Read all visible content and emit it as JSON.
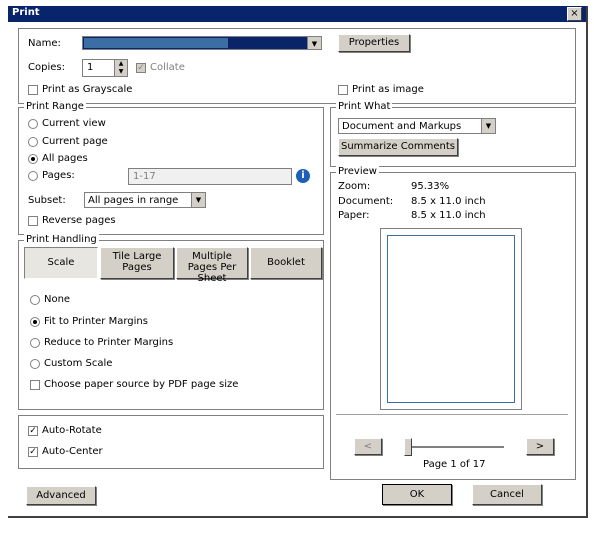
{
  "window": {
    "title": "Print",
    "close_glyph": "×"
  },
  "printer": {
    "name_label": "Name:",
    "properties_label": "Properties",
    "copies_label": "Copies:",
    "copies_value": "1",
    "collate_label": "Collate",
    "grayscale_label": "Print as Grayscale",
    "print_as_image_label": "Print as image"
  },
  "print_range": {
    "legend": "Print Range",
    "current_view": "Current view",
    "current_page": "Current page",
    "all_pages": "All pages",
    "pages_label": "Pages:",
    "pages_value": "1-17",
    "subset_label": "Subset:",
    "subset_value": "All pages in range",
    "reverse_label": "Reverse pages",
    "selected": "all_pages"
  },
  "print_handling": {
    "legend": "Print Handling",
    "buttons": [
      "Scale",
      "Tile Large Pages",
      "Multiple Pages Per Sheet",
      "Booklet"
    ],
    "none_label": "None",
    "fit_label": "Fit to Printer Margins",
    "reduce_label": "Reduce to Printer Margins",
    "custom_label": "Custom Scale",
    "paper_source_label": "Choose paper source by PDF page size"
  },
  "auto": {
    "rotate_label": "Auto-Rotate",
    "center_label": "Auto-Center"
  },
  "print_what": {
    "legend": "Print What",
    "value": "Document and Markups",
    "summarize_label": "Summarize Comments"
  },
  "preview": {
    "legend": "Preview",
    "zoom_label": "Zoom:",
    "zoom_value": "95.33%",
    "document_label": "Document:",
    "document_value": "8.5 x 11.0 inch",
    "paper_label": "Paper:",
    "paper_value": "8.5 x 11.0 inch",
    "page_text": "Page 1 of 17",
    "prev_glyph": "<",
    "next_glyph": ">"
  },
  "footer": {
    "advanced_label": "Advanced",
    "ok_label": "OK",
    "cancel_label": "Cancel"
  },
  "colors": {
    "titlebar": "#08246b",
    "selection": "#0a246a",
    "selection_light": "#3a6ea5"
  }
}
